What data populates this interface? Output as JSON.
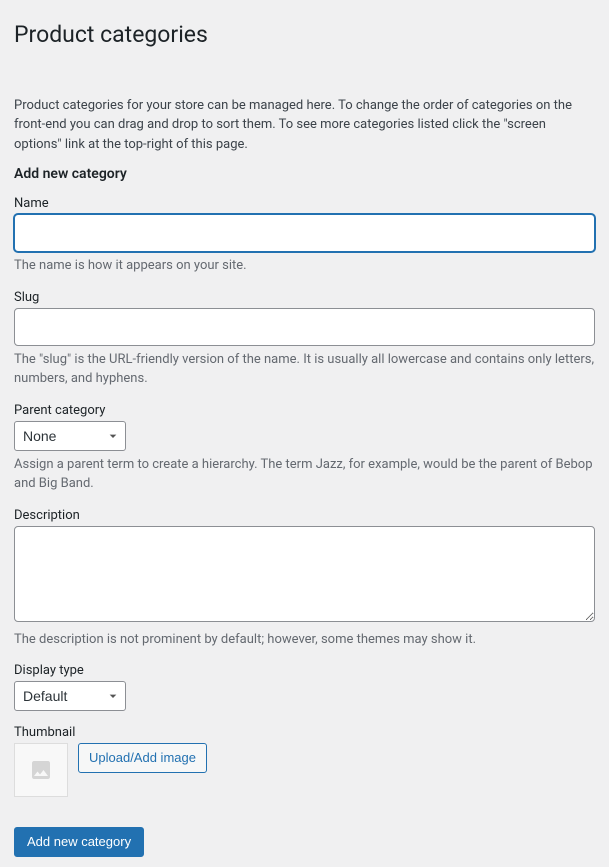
{
  "page": {
    "title": "Product categories",
    "intro": "Product categories for your store can be managed here. To change the order of categories on the front-end you can drag and drop to sort them. To see more categories listed click the \"screen options\" link at the top-right of this page."
  },
  "form": {
    "heading": "Add new category",
    "name": {
      "label": "Name",
      "value": "",
      "help": "The name is how it appears on your site."
    },
    "slug": {
      "label": "Slug",
      "value": "",
      "help": "The \"slug\" is the URL-friendly version of the name. It is usually all lowercase and contains only letters, numbers, and hyphens."
    },
    "parent": {
      "label": "Parent category",
      "selected": "None",
      "help": "Assign a parent term to create a hierarchy. The term Jazz, for example, would be the parent of Bebop and Big Band."
    },
    "description": {
      "label": "Description",
      "value": "",
      "help": "The description is not prominent by default; however, some themes may show it."
    },
    "display_type": {
      "label": "Display type",
      "selected": "Default"
    },
    "thumbnail": {
      "label": "Thumbnail",
      "upload_button": "Upload/Add image"
    },
    "submit": "Add new category"
  }
}
